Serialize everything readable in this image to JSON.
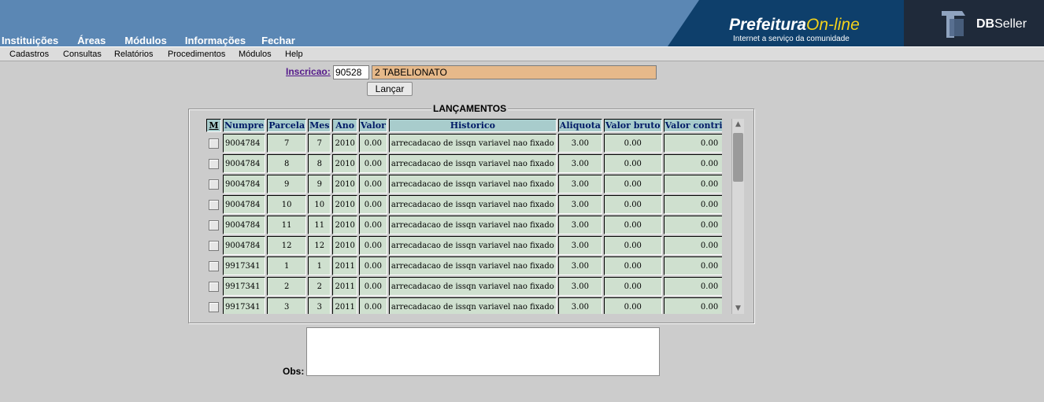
{
  "header": {
    "menu": [
      "Instituições",
      "Áreas",
      "Módulos",
      "Informações",
      "Fechar"
    ],
    "brand_title": "Prefeitura",
    "brand_title_accent": "On-line",
    "brand_subtitle": "Internet a serviço da comunidade",
    "vendor_bold": "DB",
    "vendor_rest": "Seller"
  },
  "submenu": [
    "Cadastros",
    "Consultas",
    "Relatórios",
    "Procedimentos",
    "Módulos",
    "Help"
  ],
  "form": {
    "inscricao_label": "Inscricao:",
    "inscricao_code": "90528",
    "inscricao_name": "2 TABELIONATO",
    "lancar_button": "Lançar"
  },
  "lancamentos": {
    "legend": "LANÇAMENTOS",
    "columns": [
      "M",
      "Numpre",
      "Parcela",
      "Mes",
      "Ano",
      "Valor",
      "Historico",
      "Aliquota",
      "Valor bruto",
      "Valor contribuinte"
    ],
    "rows": [
      [
        "9004784",
        "7",
        "7",
        "2010",
        "0.00",
        "arrecadacao de issqn variavel nao fixado",
        "3.00",
        "0.00",
        "0.00"
      ],
      [
        "9004784",
        "8",
        "8",
        "2010",
        "0.00",
        "arrecadacao de issqn variavel nao fixado",
        "3.00",
        "0.00",
        "0.00"
      ],
      [
        "9004784",
        "9",
        "9",
        "2010",
        "0.00",
        "arrecadacao de issqn variavel nao fixado",
        "3.00",
        "0.00",
        "0.00"
      ],
      [
        "9004784",
        "10",
        "10",
        "2010",
        "0.00",
        "arrecadacao de issqn variavel nao fixado",
        "3.00",
        "0.00",
        "0.00"
      ],
      [
        "9004784",
        "11",
        "11",
        "2010",
        "0.00",
        "arrecadacao de issqn variavel nao fixado",
        "3.00",
        "0.00",
        "0.00"
      ],
      [
        "9004784",
        "12",
        "12",
        "2010",
        "0.00",
        "arrecadacao de issqn variavel nao fixado",
        "3.00",
        "0.00",
        "0.00"
      ],
      [
        "9917341",
        "1",
        "1",
        "2011",
        "0.00",
        "arrecadacao de issqn variavel nao fixado",
        "3.00",
        "0.00",
        "0.00"
      ],
      [
        "9917341",
        "2",
        "2",
        "2011",
        "0.00",
        "arrecadacao de issqn variavel nao fixado",
        "3.00",
        "0.00",
        "0.00"
      ],
      [
        "9917341",
        "3",
        "3",
        "2011",
        "0.00",
        "arrecadacao de issqn variavel nao fixado",
        "3.00",
        "0.00",
        "0.00"
      ]
    ]
  },
  "obs": {
    "label": "Obs:",
    "value": ""
  },
  "colors": {
    "header_bg": "#5b87b4",
    "grid_header_bg": "#a8cccc",
    "grid_cell_bg": "#cfe0cf",
    "inscricao_name_bg": "#e6b98a"
  }
}
